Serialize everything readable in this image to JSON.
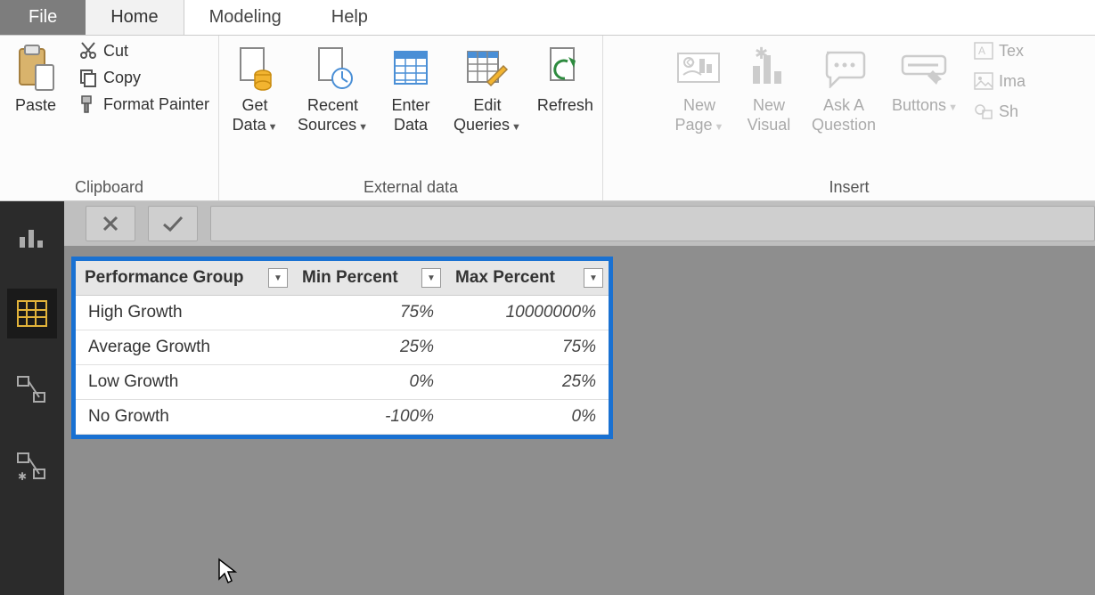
{
  "menu": {
    "file": "File",
    "home": "Home",
    "modeling": "Modeling",
    "help": "Help"
  },
  "ribbon": {
    "clipboard": {
      "label": "Clipboard",
      "paste": "Paste",
      "cut": "Cut",
      "copy": "Copy",
      "format_painter": "Format Painter"
    },
    "external": {
      "label": "External data",
      "get_data": "Get\nData",
      "recent_sources": "Recent\nSources",
      "enter_data": "Enter\nData",
      "edit_queries": "Edit\nQueries",
      "refresh": "Refresh"
    },
    "insert": {
      "label": "Insert",
      "new_page": "New\nPage",
      "new_visual": "New\nVisual",
      "ask_question": "Ask A\nQuestion",
      "buttons": "Buttons",
      "text_box": "Tex",
      "image": "Ima",
      "shapes": "Sh"
    }
  },
  "table": {
    "headers": {
      "group": "Performance Group",
      "min": "Min Percent",
      "max": "Max Percent"
    },
    "rows": [
      {
        "group": "High Growth",
        "min": "75%",
        "max": "10000000%"
      },
      {
        "group": "Average Growth",
        "min": "25%",
        "max": "75%"
      },
      {
        "group": "Low Growth",
        "min": "0%",
        "max": "25%"
      },
      {
        "group": "No Growth",
        "min": "-100%",
        "max": "0%"
      }
    ]
  }
}
